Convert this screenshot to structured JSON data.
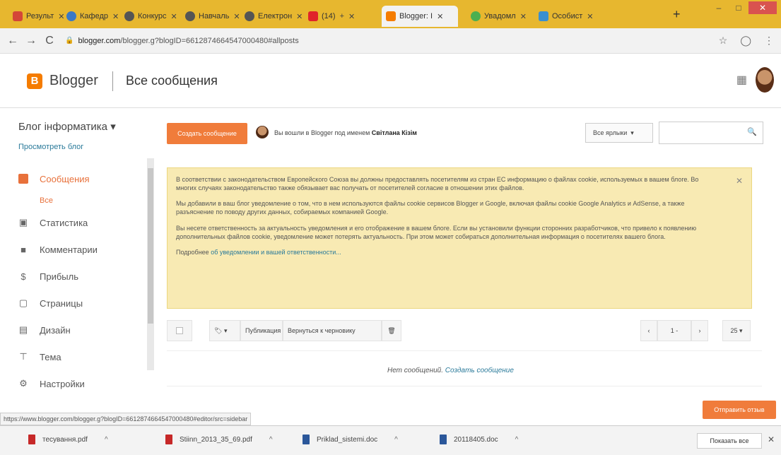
{
  "browser": {
    "tabs": [
      {
        "label": "Результ",
        "color": "#d44638"
      },
      {
        "label": "Кафедр",
        "color": "#3b78c4"
      },
      {
        "label": "Конкурс",
        "color": "#555555"
      },
      {
        "label": "Навчаль",
        "color": "#555555"
      },
      {
        "label": "Електрон",
        "color": "#555555"
      },
      {
        "label": "(14)",
        "color": "#e0232a"
      },
      {
        "label": "Blogger: I",
        "color": "#f57c00"
      },
      {
        "label": "Увадомл",
        "color": "#4caf50"
      },
      {
        "label": "Особист",
        "color": "#3a8fd0"
      }
    ],
    "new_tab": "+",
    "url_domain": "blogger.com",
    "url_path": "/blogger.g?blogID=6612874664547000480#allposts",
    "back": "←",
    "forward": "→",
    "reload": "C",
    "minimize": "–",
    "maximize": "□",
    "close": "✕"
  },
  "header": {
    "logo_letter": "B",
    "app_name": "Blogger",
    "page_title": "Все сообщения"
  },
  "sidebar": {
    "blog_name": "Блог інформатика",
    "view_blog": "Просмотреть блог",
    "items": [
      {
        "label": "Сообщения",
        "icon": "posts-icon"
      },
      {
        "label": "Статистика",
        "icon": "stats-icon"
      },
      {
        "label": "Комментарии",
        "icon": "comments-icon"
      },
      {
        "label": "Прибыль",
        "icon": "dollar-icon"
      },
      {
        "label": "Страницы",
        "icon": "pages-icon"
      },
      {
        "label": "Дизайн",
        "icon": "layout-icon"
      },
      {
        "label": "Тема",
        "icon": "theme-icon"
      },
      {
        "label": "Настройки",
        "icon": "settings-icon"
      }
    ],
    "sub_all": "Все"
  },
  "main": {
    "create_post": "Создать сообщение",
    "logged_in_prefix": "Вы вошли в Blogger под именем",
    "logged_in_user": "Світлана Кізім",
    "labels_select": "Все ярлыки",
    "notice": {
      "p1": "В соответствии с законодательством Европейского Союза вы должны предоставлять посетителям из стран ЕС информацию о файлах cookie, используемых в вашем блоге. Во многих случаях законодательство также обязывает вас получать от посетителей согласие в отношении этих файлов.",
      "p2": "Мы добавили в ваш блог уведомление о том, что в нем используются файлы cookie сервисов Blogger и Google, включая файлы cookie Google Analytics и AdSense, а также разъяснение по поводу других данных, собираемых компанией Google.",
      "p3": "Вы несете ответственность за актуальность уведомления и его отображение в вашем блоге. Если вы установили функции сторонних разработчиков, что привело к появлению дополнительных файлов cookie, уведомление может потерять актуальность. При этом может собираться дополнительная информация о посетителях вашего блога.",
      "more_prefix": "Подробнее",
      "more_link": "об уведомлении и вашей ответственности..."
    },
    "toolbar": {
      "publish": "Публикация",
      "revert": "Вернуться к черновику",
      "pagination": "1 -",
      "per_page": "25"
    },
    "empty_text": "Нет сообщений.",
    "empty_link": "Создать сообщение",
    "feedback": "Отправить отзыв"
  },
  "status_url": "https://www.blogger.com/blogger.g?blogID=6612874664547000480#editor/src=sidebar",
  "downloads": {
    "items": [
      {
        "name": "тесування.pdf",
        "color": "#c62828"
      },
      {
        "name": "Stiinn_2013_35_69.pdf",
        "color": "#c62828"
      },
      {
        "name": "Priklad_sistemi.doc",
        "color": "#2b579a"
      },
      {
        "name": "20118405.doc",
        "color": "#2b579a"
      }
    ],
    "show_all": "Показать все",
    "close": "✕"
  }
}
